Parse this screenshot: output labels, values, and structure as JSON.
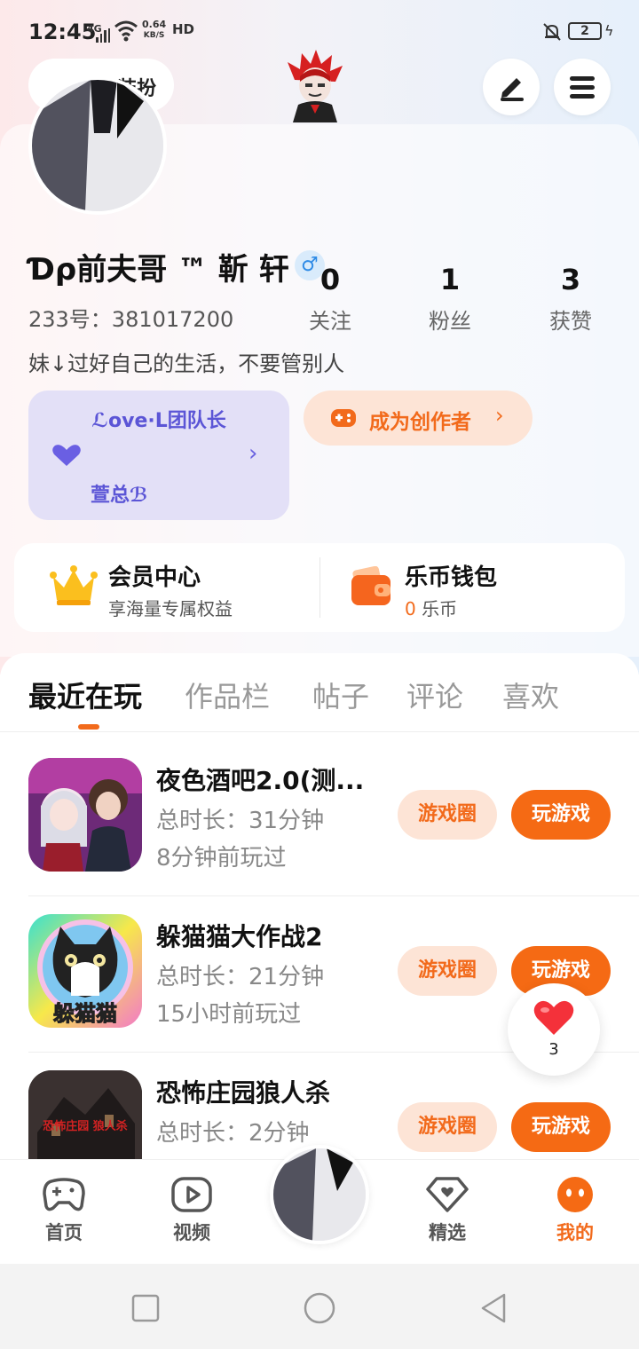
{
  "status_bar": {
    "time": "12:45",
    "network": "4G",
    "speed_value": "0.64",
    "speed_unit": "KB/S",
    "hd": "HD",
    "battery": "2"
  },
  "header": {
    "costume_label": "装扮"
  },
  "profile": {
    "stats": [
      {
        "value": "0",
        "label": "关注"
      },
      {
        "value": "1",
        "label": "粉丝"
      },
      {
        "value": "3",
        "label": "获赞"
      }
    ],
    "nickname": "Ɗρ前夫哥 ™ 靳 轩",
    "gender_symbol": "♂",
    "user_id": "233号：381017200",
    "bio": "妹↓过好自己的生活，不要管别人"
  },
  "team_card": {
    "title": "ℒove·L团队长",
    "subtitle": "萱总ℬ"
  },
  "creator_button": {
    "label": "成为创作者"
  },
  "membership": {
    "title": "会员中心",
    "subtitle": "享海量专属权益"
  },
  "wallet": {
    "title": "乐币钱包",
    "balance": "0",
    "unit": "乐币"
  },
  "tabs": [
    "最近在玩",
    "作品栏",
    "帖子",
    "评论",
    "喜欢"
  ],
  "games": [
    {
      "title": "夜色酒吧2.0(测...",
      "duration": "总时长：31分钟",
      "last_played": "8分钟前玩过",
      "circle_label": "游戏圈",
      "play_label": "玩游戏"
    },
    {
      "title": "躲猫猫大作战2",
      "duration": "总时长：21分钟",
      "last_played": "15小时前玩过",
      "circle_label": "游戏圈",
      "play_label": "玩游戏",
      "icon_text": "躲猫猫"
    },
    {
      "title": "恐怖庄园狼人杀",
      "duration": "总时长：2分钟",
      "last_played": "",
      "circle_label": "游戏圈",
      "play_label": "玩游戏",
      "icon_text": "恐怖庄园 狼人杀"
    }
  ],
  "heart_fab": {
    "count": "3"
  },
  "bottom_nav": [
    {
      "label": "首页"
    },
    {
      "label": "视频"
    },
    {
      "label": "精选"
    },
    {
      "label": "我的"
    }
  ],
  "colors": {
    "accent": "#f56a14",
    "team_purple": "#5b55d6",
    "gender_blue": "#2f8be6"
  }
}
